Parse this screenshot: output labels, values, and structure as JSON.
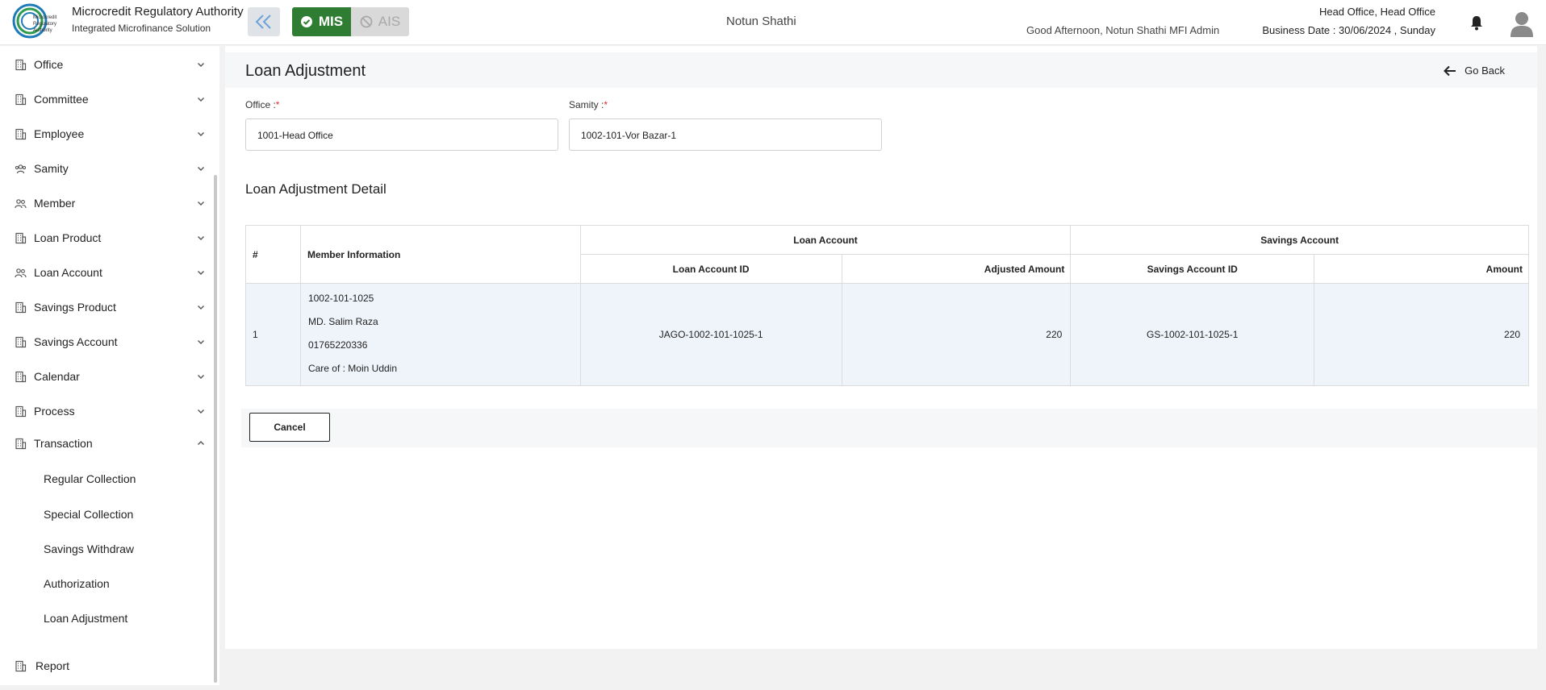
{
  "header": {
    "brand_title": "Microcredit Regulatory Authority",
    "brand_subtitle": "Integrated Microfinance Solution",
    "logo_text": "Microcredit Regulatory Authority",
    "mode_mis": "MIS",
    "mode_ais": "AIS",
    "org_name": "Notun Shathi",
    "greeting": "Good Afternoon, Notun Shathi MFI Admin",
    "office": "Head Office, Head Office",
    "business_date": "Business Date : 30/06/2024 , Sunday"
  },
  "sidebar": {
    "items": [
      {
        "label": "Office",
        "icon": "building-icon",
        "expanded": false
      },
      {
        "label": "Committee",
        "icon": "building-icon",
        "expanded": false
      },
      {
        "label": "Employee",
        "icon": "building-icon",
        "expanded": false
      },
      {
        "label": "Samity",
        "icon": "group-icon",
        "expanded": false
      },
      {
        "label": "Member",
        "icon": "people-icon",
        "expanded": false
      },
      {
        "label": "Loan Product",
        "icon": "building-icon",
        "expanded": false
      },
      {
        "label": "Loan Account",
        "icon": "people-icon",
        "expanded": false
      },
      {
        "label": "Savings Product",
        "icon": "building-icon",
        "expanded": false
      },
      {
        "label": "Savings Account",
        "icon": "building-icon",
        "expanded": false
      },
      {
        "label": "Calendar",
        "icon": "building-icon",
        "expanded": false
      },
      {
        "label": "Process",
        "icon": "building-icon",
        "expanded": false
      },
      {
        "label": "Transaction",
        "icon": "building-icon",
        "expanded": true
      }
    ],
    "sub_items": [
      "Regular Collection",
      "Special Collection",
      "Savings Withdraw",
      "Authorization",
      "Loan Adjustment"
    ],
    "report_label": "Report"
  },
  "page": {
    "title": "Loan Adjustment",
    "go_back": "Go Back",
    "office_label": "Office :",
    "office_value": "1001-Head Office",
    "samity_label": "Samity :",
    "samity_value": "1002-101-Vor Bazar-1",
    "required_mark": "*",
    "section_title": "Loan Adjustment Detail",
    "cancel": "Cancel"
  },
  "table": {
    "headers": {
      "num": "#",
      "member": "Member Information",
      "loan_group": "Loan Account",
      "savings_group": "Savings Account",
      "loan_id": "Loan Account ID",
      "adjusted": "Adjusted Amount",
      "savings_id": "Savings Account ID",
      "amount": "Amount"
    },
    "rows": [
      {
        "num": "1",
        "member_id": "1002-101-1025",
        "member_name": "MD. Salim Raza",
        "phone": "01765220336",
        "care_of": "Care of : Moin Uddin",
        "loan_id": "JAGO-1002-101-1025-1",
        "adjusted": "220",
        "savings_id": "GS-1002-101-1025-1",
        "amount": "220"
      }
    ]
  },
  "colors": {
    "mis_active": "#2e7d32",
    "ais_inactive": "#d9d9d9",
    "required": "#d32f2f",
    "row_bg": "#eff4fb"
  }
}
